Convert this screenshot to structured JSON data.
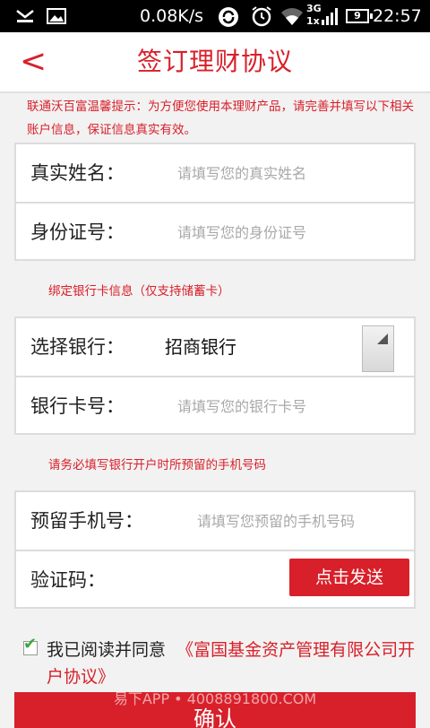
{
  "status_bar": {
    "network_speed": "0.08K/s",
    "signal_type": "3G",
    "signal_sub": "1x",
    "battery": "9",
    "time": "22:57",
    "icons": [
      "notification-icon",
      "image-icon",
      "sync-icon",
      "alarm-icon",
      "wifi-icon",
      "signal-icon",
      "battery-icon"
    ]
  },
  "header": {
    "back_label": "<",
    "title": "签订理财协议"
  },
  "notice": "联通沃百富温馨提示：为方便您使用本理财产品，请完善并填写以下相关账户信息，保证信息真实有效。",
  "identity": {
    "name_label": "真实姓名：",
    "name_placeholder": "请填写您的真实姓名",
    "id_label": "身份证号：",
    "id_placeholder": "请填写您的身份证号"
  },
  "bank_hint": "绑定银行卡信息（仅支持储蓄卡）",
  "bank": {
    "select_label": "选择银行：",
    "selected_bank": "招商银行",
    "card_label": "银行卡号：",
    "card_placeholder": "请填写您的银行卡号"
  },
  "phone_hint": "请务必填写银行开户时所预留的手机号码",
  "phone": {
    "phone_label": "预留手机号：",
    "phone_placeholder": "请填写您预留的手机号码",
    "code_label": "验证码：",
    "send_label": "点击发送"
  },
  "agreement": {
    "checked": true,
    "text": "我已阅读并同意",
    "link": "《富国基金资产管理有限公司开户协议》"
  },
  "confirm_label": "确认",
  "watermark": "易下APP • 4008891800.COM",
  "colors": {
    "accent": "#d8202a",
    "check": "#3fa53f"
  }
}
